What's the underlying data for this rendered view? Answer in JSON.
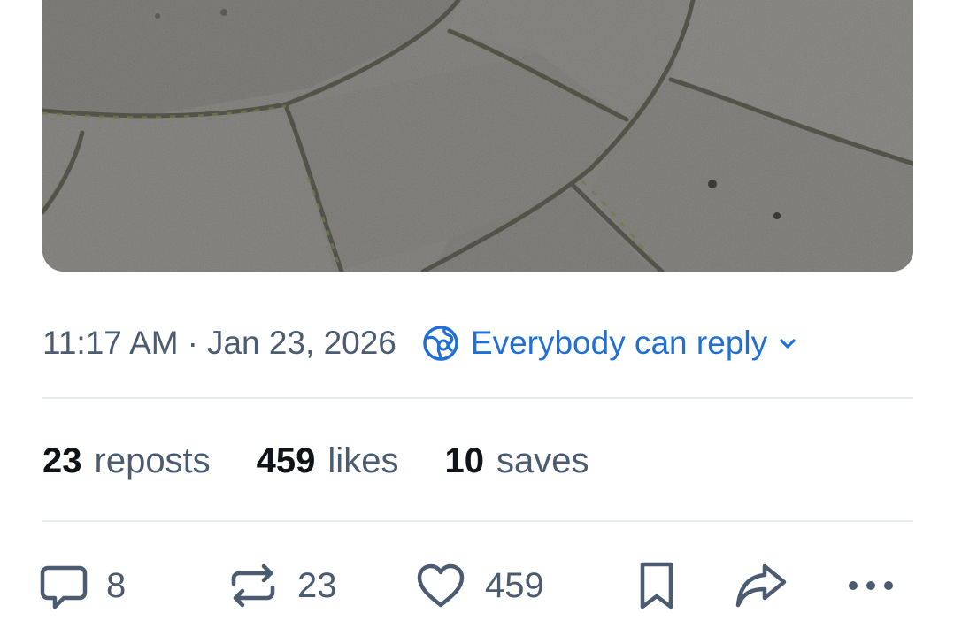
{
  "post": {
    "image": {
      "description_icon": "paving-stones-photo"
    },
    "time": "11:17 AM",
    "separator": "·",
    "date": "Jan 23, 2026",
    "reply_setting": {
      "icon": "globe-icon",
      "label": "Everybody can reply",
      "chevron": "chevron-down-icon"
    },
    "stats": {
      "reposts": {
        "count": "23",
        "label": "reposts"
      },
      "likes": {
        "count": "459",
        "label": "likes"
      },
      "saves": {
        "count": "10",
        "label": "saves"
      }
    },
    "actions": {
      "reply": {
        "icon": "reply-icon",
        "count": "8"
      },
      "repost": {
        "icon": "repost-icon",
        "count": "23"
      },
      "like": {
        "icon": "heart-icon",
        "count": "459"
      },
      "bookmark": {
        "icon": "bookmark-icon"
      },
      "share": {
        "icon": "share-icon"
      },
      "more": {
        "icon": "more-icon"
      }
    }
  },
  "colors": {
    "accent": "#1f6fd6",
    "text_primary": "#0f1419",
    "text_secondary": "#4b5b70",
    "divider": "#e8ebef"
  }
}
